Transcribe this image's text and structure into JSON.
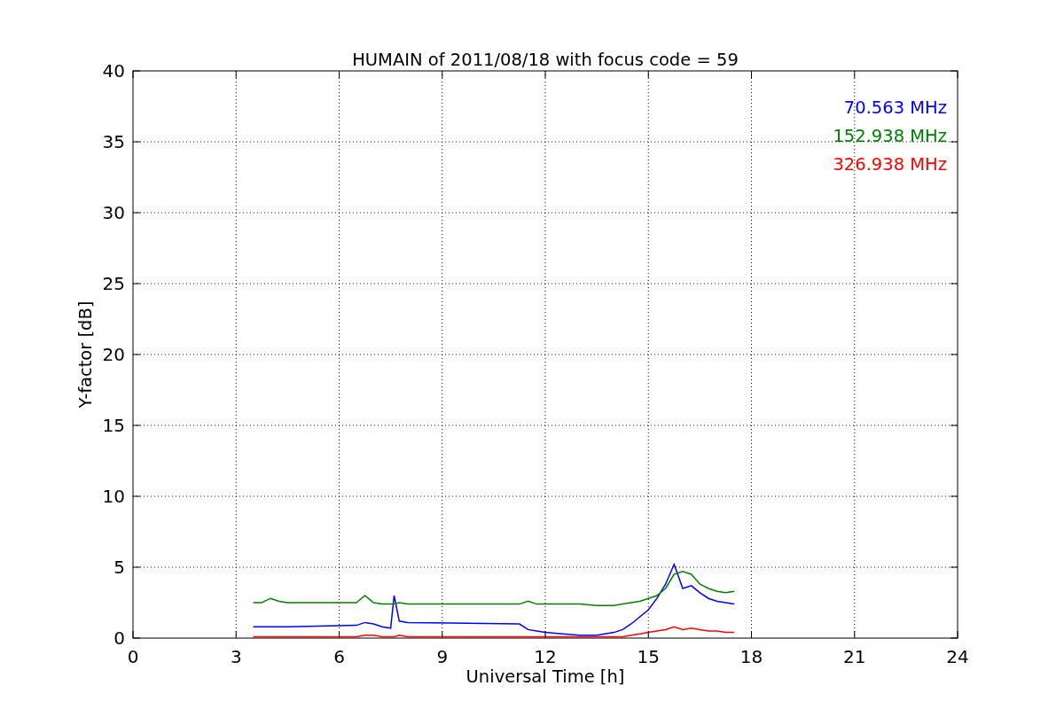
{
  "chart_data": {
    "type": "line",
    "title": "HUMAIN of 2011/08/18 with focus code = 59",
    "xlabel": "Universal Time [h]",
    "ylabel": "Y-factor [dB]",
    "x": [
      3.5,
      3.75,
      4,
      4.25,
      4.5,
      6.5,
      6.75,
      7,
      7.25,
      7.5,
      7.6,
      7.75,
      8,
      11.25,
      11.5,
      11.75,
      12,
      12.5,
      13,
      13.5,
      14,
      14.25,
      14.5,
      14.75,
      15,
      15.25,
      15.5,
      15.75,
      16,
      16.25,
      16.5,
      16.75,
      17,
      17.25,
      17.5
    ],
    "series": [
      {
        "name": "70.563 MHz",
        "color": "#0000ff",
        "values": [
          0.8,
          0.8,
          0.8,
          0.8,
          0.8,
          0.9,
          1.1,
          1.0,
          0.8,
          0.7,
          3.0,
          1.2,
          1.1,
          1.0,
          0.6,
          0.5,
          0.4,
          0.3,
          0.2,
          0.2,
          0.4,
          0.6,
          1.0,
          1.5,
          2.0,
          2.8,
          3.8,
          5.2,
          3.5,
          3.7,
          3.2,
          2.8,
          2.6,
          2.5,
          2.4
        ]
      },
      {
        "name": "152.938 MHz",
        "color": "#008000",
        "values": [
          2.5,
          2.5,
          2.8,
          2.6,
          2.5,
          2.5,
          3.0,
          2.5,
          2.4,
          2.4,
          2.4,
          2.5,
          2.4,
          2.4,
          2.6,
          2.4,
          2.4,
          2.4,
          2.4,
          2.3,
          2.3,
          2.4,
          2.5,
          2.6,
          2.8,
          3.0,
          3.5,
          4.5,
          4.7,
          4.5,
          3.8,
          3.5,
          3.3,
          3.2,
          3.3
        ]
      },
      {
        "name": "326.938 MHz",
        "color": "#ff0000",
        "values": [
          0.1,
          0.1,
          0.1,
          0.1,
          0.1,
          0.1,
          0.2,
          0.2,
          0.1,
          0.1,
          0.1,
          0.2,
          0.1,
          0.1,
          0.1,
          0.1,
          0.1,
          0.1,
          0.1,
          0.1,
          0.1,
          0.1,
          0.2,
          0.3,
          0.4,
          0.5,
          0.6,
          0.8,
          0.6,
          0.7,
          0.6,
          0.5,
          0.5,
          0.4,
          0.4
        ]
      }
    ],
    "grid": true,
    "xlim": [
      0,
      24
    ],
    "ylim": [
      0,
      40
    ],
    "xticks": [
      0,
      3,
      6,
      9,
      12,
      15,
      18,
      21,
      24
    ],
    "yticks": [
      0,
      5,
      10,
      15,
      20,
      25,
      30,
      35,
      40
    ]
  }
}
